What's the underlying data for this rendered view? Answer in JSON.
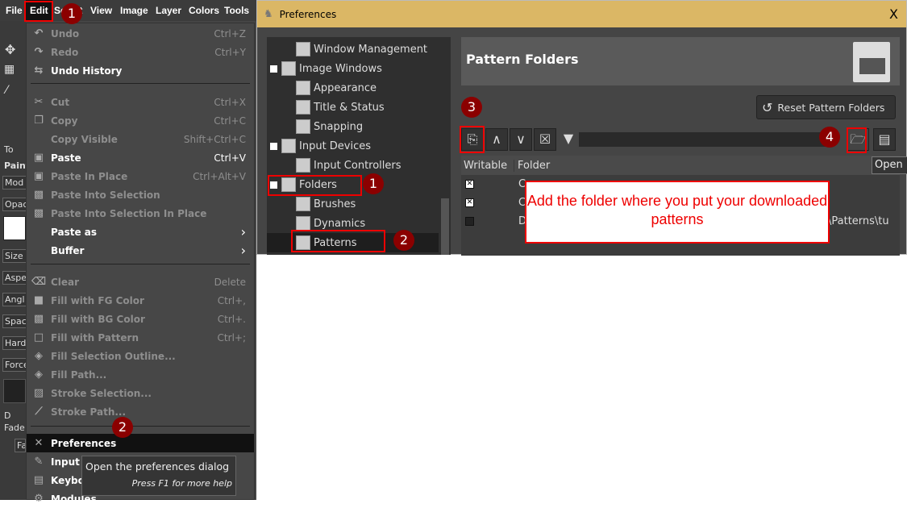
{
  "menubar": [
    "File",
    "Edit",
    "Select",
    "View",
    "Image",
    "Layer",
    "Colors",
    "Tools"
  ],
  "toolbox": {
    "labels": [
      "To",
      "Paint",
      "Mod",
      "Opac",
      "Size",
      "Aspe",
      "Angl",
      "Spac",
      "Hard",
      "Force",
      "D",
      "Fade",
      "Fa",
      "R"
    ]
  },
  "edit_menu": {
    "items": [
      {
        "label": "Undo",
        "shortcut": "Ctrl+Z",
        "enabled": false,
        "icon": "undo-icon"
      },
      {
        "label": "Redo",
        "shortcut": "Ctrl+Y",
        "enabled": false,
        "icon": "redo-icon"
      },
      {
        "label": "Undo History",
        "shortcut": "",
        "enabled": true,
        "icon": "undo-history-icon"
      },
      {
        "label": "Cut",
        "shortcut": "Ctrl+X",
        "enabled": false,
        "icon": "scissors-icon"
      },
      {
        "label": "Copy",
        "shortcut": "Ctrl+C",
        "enabled": false,
        "icon": "copy-icon"
      },
      {
        "label": "Copy Visible",
        "shortcut": "Shift+Ctrl+C",
        "enabled": false,
        "icon": ""
      },
      {
        "label": "Paste",
        "shortcut": "Ctrl+V",
        "enabled": true,
        "icon": "paste-icon"
      },
      {
        "label": "Paste In Place",
        "shortcut": "Ctrl+Alt+V",
        "enabled": false,
        "icon": "paste-in-place-icon"
      },
      {
        "label": "Paste Into Selection",
        "shortcut": "",
        "enabled": false,
        "icon": "paste-into-icon"
      },
      {
        "label": "Paste Into Selection In Place",
        "shortcut": "",
        "enabled": false,
        "icon": "paste-into-icon"
      },
      {
        "label": "Paste as",
        "shortcut": "›",
        "enabled": true,
        "icon": ""
      },
      {
        "label": "Buffer",
        "shortcut": "›",
        "enabled": true,
        "icon": ""
      },
      {
        "label": "Clear",
        "shortcut": "Delete",
        "enabled": false,
        "icon": "clear-icon"
      },
      {
        "label": "Fill with FG Color",
        "shortcut": "Ctrl+,",
        "enabled": false,
        "icon": "fg-color-icon"
      },
      {
        "label": "Fill with BG Color",
        "shortcut": "Ctrl+.",
        "enabled": false,
        "icon": "bg-color-icon"
      },
      {
        "label": "Fill with Pattern",
        "shortcut": "Ctrl+;",
        "enabled": false,
        "icon": "pattern-icon"
      },
      {
        "label": "Fill Selection Outline...",
        "shortcut": "",
        "enabled": false,
        "icon": "bucket-icon"
      },
      {
        "label": "Fill Path...",
        "shortcut": "",
        "enabled": false,
        "icon": "bucket-icon"
      },
      {
        "label": "Stroke Selection...",
        "shortcut": "",
        "enabled": false,
        "icon": "stroke-icon"
      },
      {
        "label": "Stroke Path...",
        "shortcut": "",
        "enabled": false,
        "icon": "stroke-path-icon"
      },
      {
        "label": "Preferences",
        "shortcut": "",
        "enabled": true,
        "icon": "tools-icon"
      },
      {
        "label": "Input Devices",
        "shortcut": "",
        "enabled": true,
        "icon": "input-devices-icon"
      },
      {
        "label": "Keyboard Shortcuts",
        "shortcut": "",
        "enabled": true,
        "icon": "keyboard-icon"
      },
      {
        "label": "Modules",
        "shortcut": "",
        "enabled": true,
        "icon": "gear-icon"
      }
    ]
  },
  "tooltip": {
    "text": "Open the preferences dialog",
    "hint": "Press F1 for more help"
  },
  "badges": {
    "b1": "1",
    "b2": "2",
    "b3": "3",
    "b4": "4"
  },
  "dialog": {
    "title": "Preferences",
    "close": "X",
    "tree": [
      {
        "label": "Window Management",
        "level": 1
      },
      {
        "label": "Image Windows",
        "level": 0
      },
      {
        "label": "Appearance",
        "level": 1
      },
      {
        "label": "Title & Status",
        "level": 1
      },
      {
        "label": "Snapping",
        "level": 1
      },
      {
        "label": "Input Devices",
        "level": 0
      },
      {
        "label": "Input Controllers",
        "level": 1
      },
      {
        "label": "Folders",
        "level": 0
      },
      {
        "label": "Brushes",
        "level": 1
      },
      {
        "label": "Dynamics",
        "level": 1
      },
      {
        "label": "Patterns",
        "level": 1,
        "selected": true
      }
    ],
    "header": "Pattern Folders",
    "reset_button": "Reset Pattern Folders",
    "path_value": "",
    "columns": [
      "Writable",
      "Folder"
    ],
    "rows": [
      {
        "writable": true,
        "folder": "C"
      },
      {
        "writable": true,
        "folder": "C"
      },
      {
        "writable": false,
        "folder": "D",
        "tail": "\\Patterns\\tu"
      }
    ],
    "open_tooltip": "Open a"
  },
  "callout": "Add the folder where you put your downloaded patterns",
  "colors": {
    "title_bar": "#dbb765",
    "annotation": "#e00000",
    "badge": "#8b0000"
  }
}
